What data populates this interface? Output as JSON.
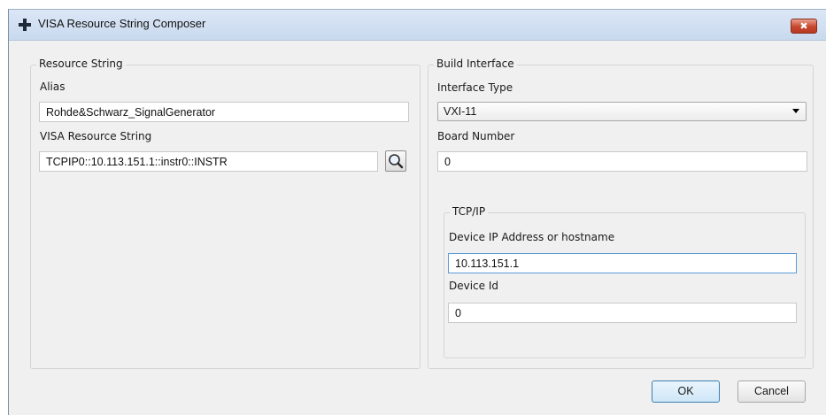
{
  "window": {
    "title": "VISA Resource String Composer",
    "close_glyph": "✖"
  },
  "resource_string": {
    "group_title": "Resource String",
    "alias_label": "Alias",
    "alias_value": "Rohde&Schwarz_SignalGenerator",
    "visa_label": "VISA Resource String",
    "visa_value": "TCPIP0::10.113.151.1::instr0::INSTR"
  },
  "build_interface": {
    "group_title": "Build Interface",
    "interface_type_label": "Interface Type",
    "interface_type_value": "VXI-11",
    "board_number_label": "Board Number",
    "board_number_value": "0",
    "tcpip": {
      "group_title": "TCP/IP",
      "ip_label": "Device IP Address or hostname",
      "ip_value": "10.113.151.1",
      "device_id_label": "Device Id",
      "device_id_value": "0"
    }
  },
  "buttons": {
    "ok": "OK",
    "cancel": "Cancel"
  },
  "icons": {
    "app": "plus-icon",
    "browse": "magnifier-icon"
  },
  "colors": {
    "title_bar": "#c9d9ee",
    "close_button": "#c8462e",
    "focus_border": "#5d9ad8"
  }
}
